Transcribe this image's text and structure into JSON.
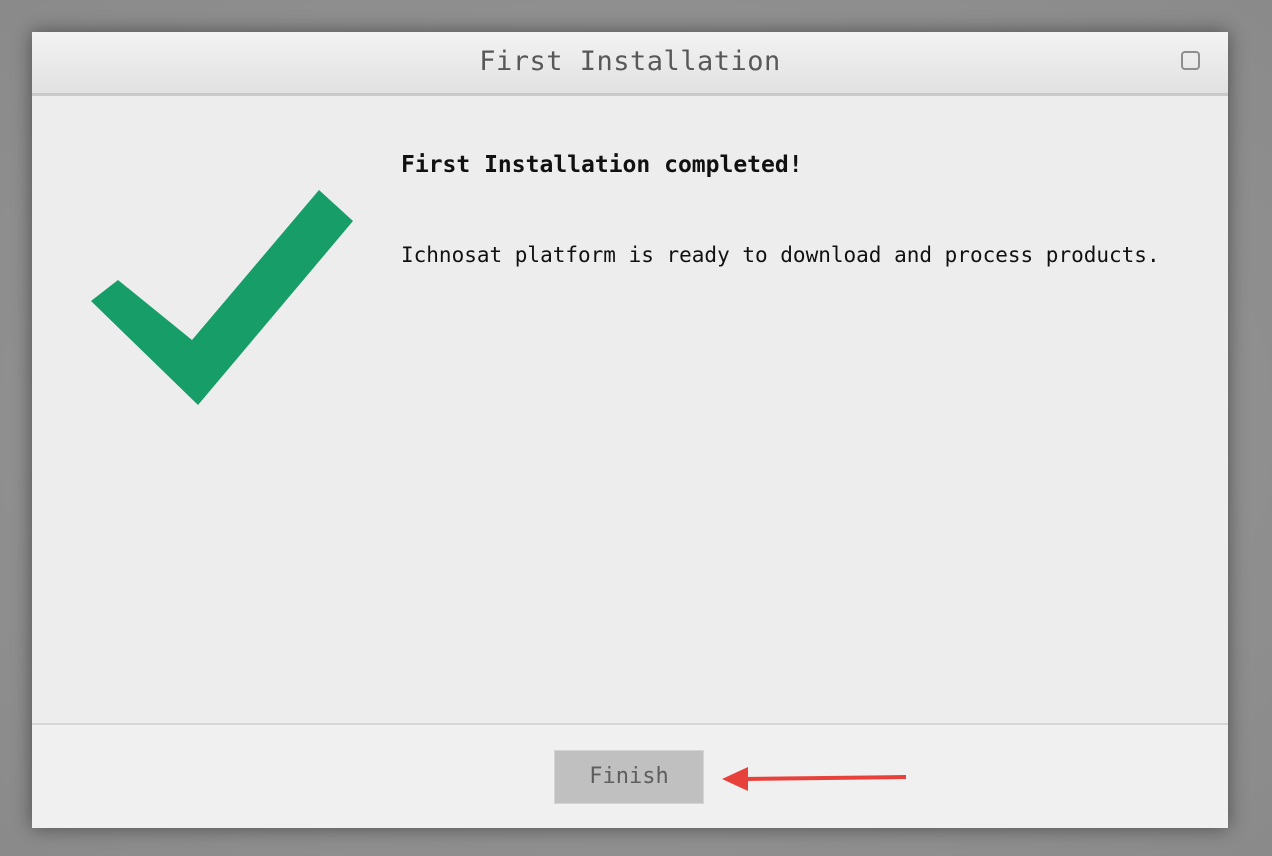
{
  "window": {
    "title": "First Installation"
  },
  "content": {
    "heading": "First Installation completed!",
    "message": "Ichnosat platform is ready to download and process products.",
    "status_icon": "checkmark-icon",
    "accent_color": "#169d68"
  },
  "footer": {
    "finish_label": "Finish"
  },
  "annotation": {
    "icon": "arrow-left-icon",
    "color": "#e8403a"
  }
}
